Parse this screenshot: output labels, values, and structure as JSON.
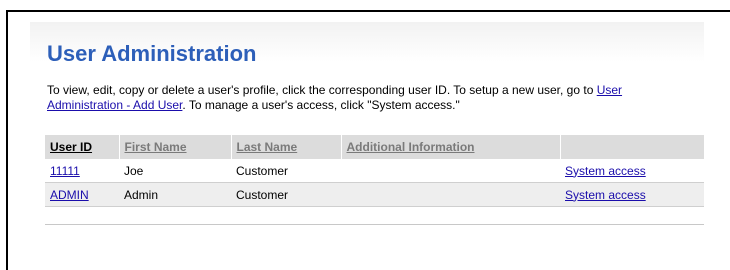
{
  "page": {
    "title": "User Administration",
    "intro_before_link": "To view, edit, copy or delete a user's profile, click the corresponding user ID. To setup a new user, go to ",
    "intro_link": "User Administration - Add User",
    "intro_after_link": ". To manage a user's access, click \"System access.\""
  },
  "table": {
    "headers": {
      "user_id": "User ID",
      "first_name": "First Name",
      "last_name": "Last Name",
      "additional_info": "Additional Information",
      "access": ""
    },
    "rows": [
      {
        "user_id": "11111",
        "first_name": "Joe",
        "last_name": "Customer",
        "additional_info": "",
        "access": "System access"
      },
      {
        "user_id": "ADMIN",
        "first_name": "Admin",
        "last_name": "Customer",
        "additional_info": "",
        "access": "System access"
      }
    ]
  },
  "colors": {
    "title": "#2d5fb9",
    "link": "#1a0dab",
    "header_bg": "#dcdcdc",
    "alt_row_bg": "#eeeeee"
  }
}
